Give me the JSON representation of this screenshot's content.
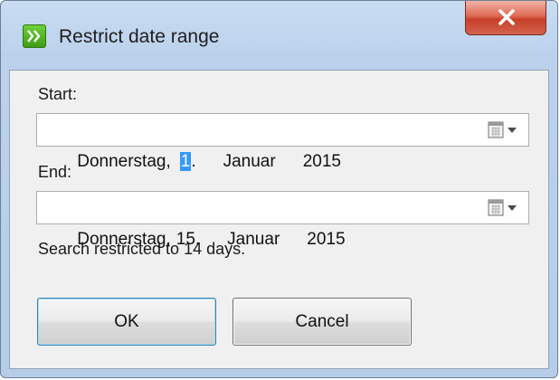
{
  "window": {
    "title": "Restrict date range"
  },
  "start": {
    "label": "Start:",
    "weekday": "Donnerstag,",
    "day": "1",
    "month": "Januar",
    "year": "2015"
  },
  "end": {
    "label": "End:",
    "weekday": "Donnerstag,",
    "day": "15",
    "month": "Januar",
    "year": "2015"
  },
  "status": {
    "text": "Search restricted to 14 days."
  },
  "buttons": {
    "ok_label": "OK",
    "cancel_label": "Cancel"
  },
  "icons": {
    "app": "double-chevron-right-icon",
    "close": "close-icon",
    "calendar": "calendar-dropdown-icon"
  },
  "colors": {
    "selection": "#3399ff",
    "close_button": "#c7402a",
    "app_icon": "#4fae22"
  }
}
